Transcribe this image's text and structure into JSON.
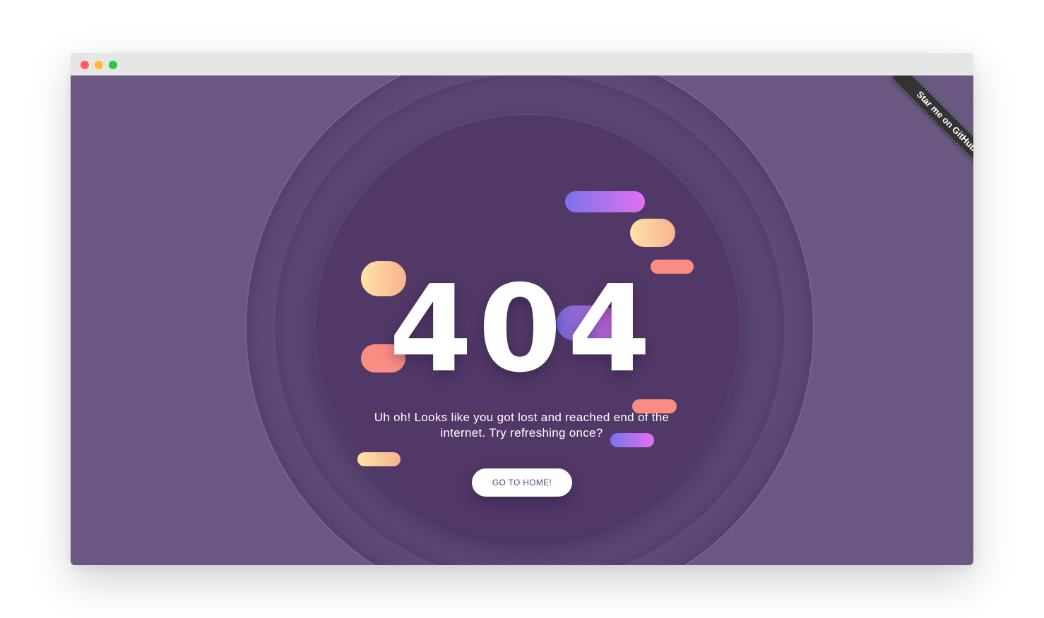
{
  "error": {
    "code": "404",
    "message": "Uh oh! Looks like you got lost and reached end of the internet. Try refreshing once?",
    "home_button_label": "GO TO HOME!"
  },
  "ribbon": {
    "label": "Star me on GitHub"
  },
  "window_controls": [
    "close-dot",
    "minimize-dot",
    "zoom-dot"
  ],
  "colors": {
    "background": "#6b5882",
    "ring_outer": "#5e4a77",
    "ring_inner": "#523866",
    "accent_purple_start": "#7b72e9",
    "accent_purple_end": "#e271f0",
    "accent_peach_start": "#fee3a8",
    "accent_peach_end": "#f9b28f",
    "accent_salmon": "#f98d84",
    "button_text": "#5b4775",
    "ribbon": "#333333"
  }
}
